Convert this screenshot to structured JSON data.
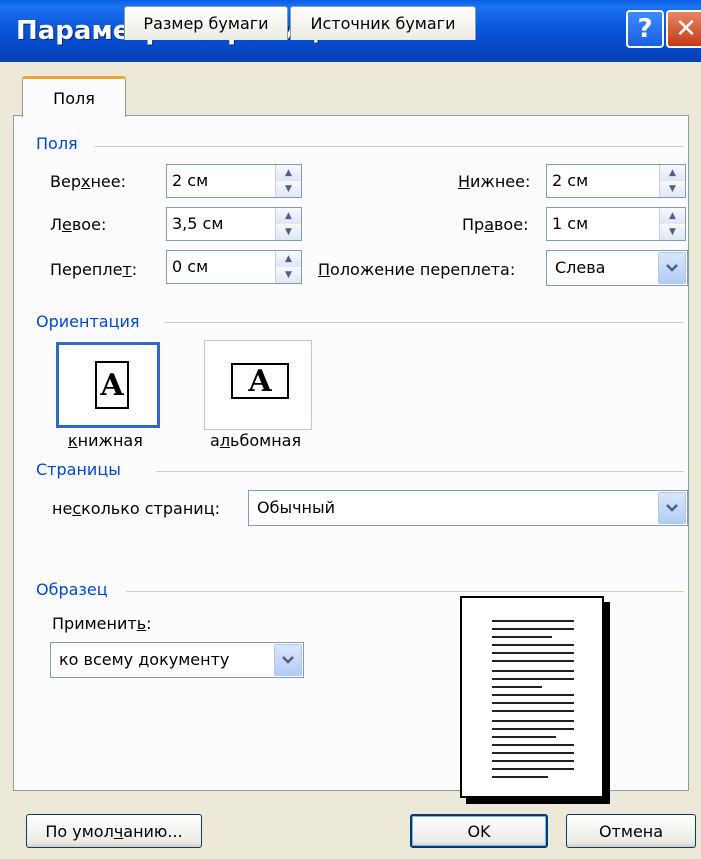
{
  "window": {
    "title": "Параметры страницы",
    "help_label": "?",
    "close_label": "✕"
  },
  "tabs": [
    {
      "label": "Поля",
      "active": true
    },
    {
      "label": "Размер бумаги",
      "active": false
    },
    {
      "label": "Источник бумаги",
      "active": false
    }
  ],
  "margins": {
    "section_label": "Поля",
    "top": {
      "label": "Верхнее:",
      "value": "2 см"
    },
    "bottom": {
      "label": "Нижнее:",
      "value": "2 см"
    },
    "left": {
      "label": "Левое:",
      "value": "3,5 см"
    },
    "right": {
      "label": "Правое:",
      "value": "1 см"
    },
    "gutter": {
      "label": "Переплет:",
      "value": "0 см"
    },
    "gutter_position": {
      "label": "Положение переплета:",
      "value": "Слева"
    }
  },
  "orientation": {
    "section_label": "Ориентация",
    "portrait": {
      "label": "книжная",
      "glyph": "A",
      "selected": true
    },
    "landscape": {
      "label": "альбомная",
      "glyph": "A",
      "selected": false
    }
  },
  "pages": {
    "section_label": "Страницы",
    "multiple_label": "несколько страниц:",
    "multiple_value": "Обычный"
  },
  "preview": {
    "section_label": "Образец",
    "apply_label": "Применить:",
    "apply_value": "ко всему документу"
  },
  "buttons": {
    "default_label": "По умолчанию...",
    "ok_label": "OK",
    "cancel_label": "Отмена"
  },
  "colors": {
    "title_bar": "#0a55d8",
    "section_text": "#0046d5",
    "dialog_bg": "#ece9d8",
    "tab_highlight": "#f1a330"
  }
}
